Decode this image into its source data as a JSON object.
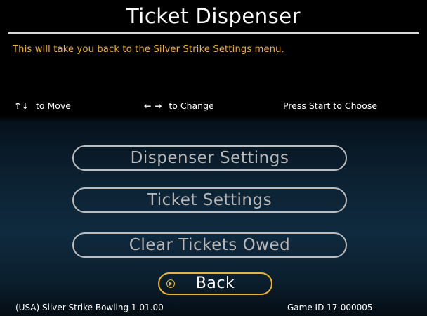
{
  "header": {
    "title": "Ticket Dispenser"
  },
  "description": "This will take you back to the Silver Strike Settings menu.",
  "help": {
    "move_arrows": "↑↓",
    "move_text": "to Move",
    "change_arrows": "← →",
    "change_text": "to Change",
    "start_text": "Press Start to Choose"
  },
  "menu": {
    "items": [
      {
        "label": "Dispenser Settings",
        "selected": false
      },
      {
        "label": "Ticket Settings",
        "selected": false
      },
      {
        "label": "Clear Tickets Owed",
        "selected": false
      },
      {
        "label": "Back",
        "selected": true
      }
    ]
  },
  "footer": {
    "version": "(USA) Silver Strike Bowling 1.01.00",
    "game_id": "Game ID 17-000005"
  },
  "colors": {
    "accent": "#f2b51d",
    "text": "#ffffff",
    "menu_text": "#b8b8b8",
    "menu_border": "#bdbdbd",
    "background_top": "#000000",
    "background_bottom": "#0f2a3e"
  },
  "icons": {
    "selector": "play-circle-icon",
    "move": "up-down-arrows-icon",
    "change": "left-right-arrows-icon"
  }
}
